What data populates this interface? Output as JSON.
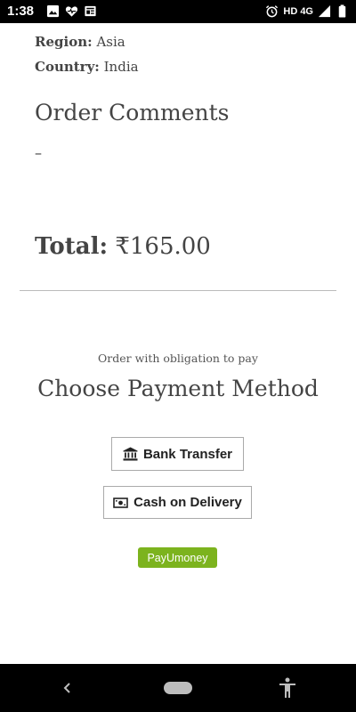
{
  "status_bar": {
    "time": "1:38",
    "left_icons": [
      "image-icon",
      "heart-icon",
      "news-icon"
    ],
    "right_icons": [
      "alarm-icon",
      "network-label",
      "signal-icon",
      "battery-icon"
    ],
    "network_label": "HD 4G"
  },
  "order": {
    "region_label": "Region:",
    "region_value": "Asia",
    "country_label": "Country:",
    "country_value": "India",
    "comments_title": "Order Comments",
    "comments_value": "–",
    "total_label": "Total:",
    "total_value": "₹165.00"
  },
  "payment": {
    "obligation_text": "Order with obligation to pay",
    "title": "Choose Payment Method",
    "bank_transfer_label": "Bank Transfer",
    "cash_on_delivery_label": "Cash on Delivery",
    "payu_label": "PayUmoney",
    "payu_color": "#7cb31e"
  },
  "nav_bar": {
    "icons": [
      "back-icon",
      "home-pill",
      "accessibility-icon"
    ]
  }
}
